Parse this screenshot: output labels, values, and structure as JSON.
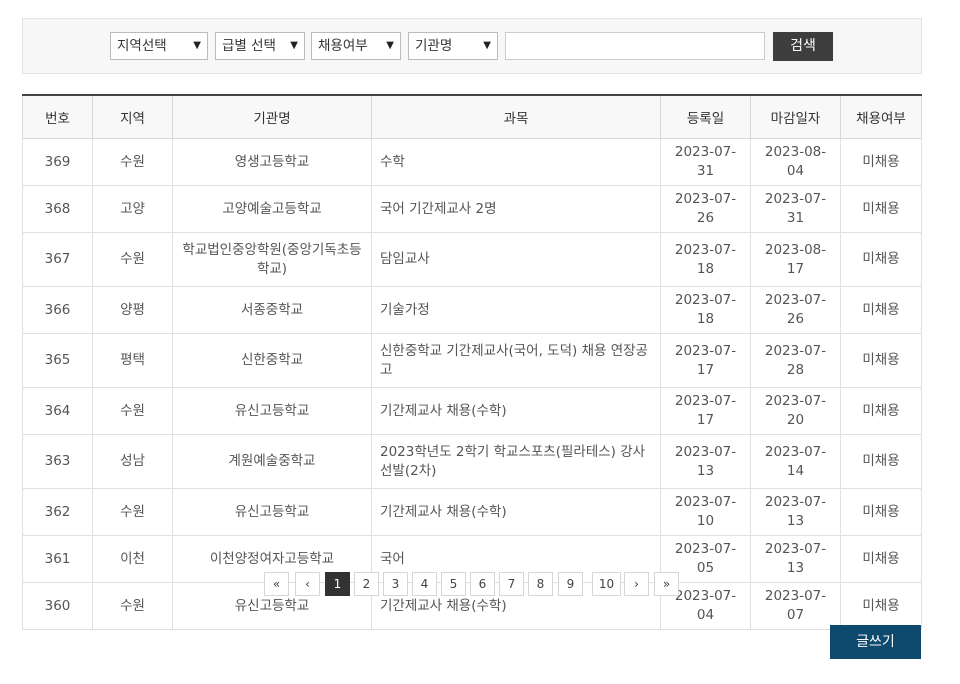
{
  "search": {
    "region_select": "지역선택",
    "grade_select": "급별 선택",
    "hire_select": "채용여부",
    "field_select": "기관명",
    "keyword_value": "",
    "search_label": "검색"
  },
  "table": {
    "headers": [
      "번호",
      "지역",
      "기관명",
      "과목",
      "등록일",
      "마감일자",
      "채용여부"
    ],
    "rows": [
      [
        "369",
        "수원",
        "영생고등학교",
        "수학",
        "2023-07-31",
        "2023-08-04",
        "미채용"
      ],
      [
        "368",
        "고양",
        "고양예술고등학교",
        "국어 기간제교사 2명",
        "2023-07-26",
        "2023-07-31",
        "미채용"
      ],
      [
        "367",
        "수원",
        "학교법인중앙학원(중앙기독초등학교)",
        "담임교사",
        "2023-07-18",
        "2023-08-17",
        "미채용"
      ],
      [
        "366",
        "양평",
        "서종중학교",
        "기술가정",
        "2023-07-18",
        "2023-07-26",
        "미채용"
      ],
      [
        "365",
        "평택",
        "신한중학교",
        "신한중학교 기간제교사(국어, 도덕) 채용 연장공고",
        "2023-07-17",
        "2023-07-28",
        "미채용"
      ],
      [
        "364",
        "수원",
        "유신고등학교",
        "기간제교사 채용(수학)",
        "2023-07-17",
        "2023-07-20",
        "미채용"
      ],
      [
        "363",
        "성남",
        "계원예술중학교",
        "2023학년도 2학기 학교스포츠(필라테스) 강사 선발(2차)",
        "2023-07-13",
        "2023-07-14",
        "미채용"
      ],
      [
        "362",
        "수원",
        "유신고등학교",
        "기간제교사 채용(수학)",
        "2023-07-10",
        "2023-07-13",
        "미채용"
      ],
      [
        "361",
        "이천",
        "이천양정여자고등학교",
        "국어",
        "2023-07-05",
        "2023-07-13",
        "미채용"
      ],
      [
        "360",
        "수원",
        "유신고등학교",
        "기간제교사 채용(수학)",
        "2023-07-04",
        "2023-07-07",
        "미채용"
      ]
    ]
  },
  "pagination": {
    "first": "«",
    "prev": "‹",
    "pages": [
      "1",
      "2",
      "3",
      "4",
      "5",
      "6",
      "7",
      "8",
      "9",
      "10"
    ],
    "active_page": "1",
    "next": "›",
    "last": "»"
  },
  "write_label": "글쓰기"
}
